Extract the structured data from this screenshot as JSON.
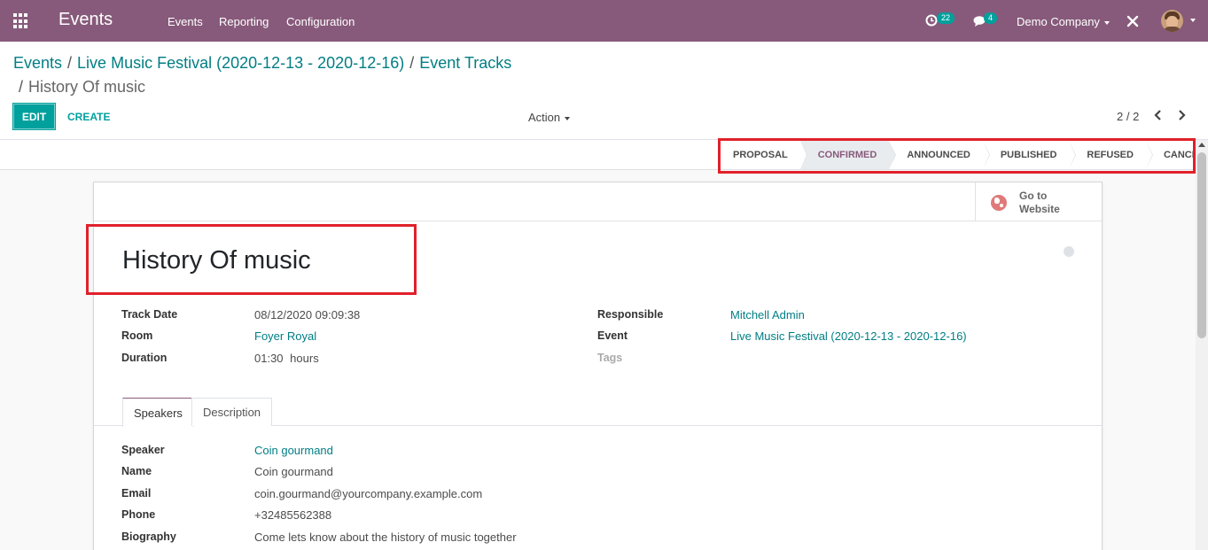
{
  "navbar": {
    "brand": "Events",
    "menu": [
      "Events",
      "Reporting",
      "Configuration"
    ],
    "activity_count": "22",
    "message_count": "4",
    "company": "Demo Company"
  },
  "breadcrumb": {
    "root": "Events",
    "event": "Live Music Festival (2020-12-13 - 2020-12-16)",
    "tracks": "Event Tracks",
    "current": "History Of music"
  },
  "toolbar": {
    "edit_label": "EDIT",
    "create_label": "CREATE",
    "action_label": "Action",
    "pager": "2 / 2"
  },
  "statusbar": {
    "states": [
      "PROPOSAL",
      "CONFIRMED",
      "ANNOUNCED",
      "PUBLISHED",
      "REFUSED",
      "CANCELLED"
    ],
    "active": "CONFIRMED"
  },
  "sheet": {
    "website_button": "Go to Website",
    "title": "History Of music",
    "left_fields": [
      {
        "label": "Track Date",
        "value": "08/12/2020 09:09:38"
      },
      {
        "label": "Room",
        "value": "Foyer Royal"
      },
      {
        "label": "Duration",
        "value": "01:30",
        "unit": "hours"
      }
    ],
    "right_fields": [
      {
        "label": "Responsible",
        "value": "Mitchell Admin"
      },
      {
        "label": "Event",
        "value": "Live Music Festival (2020-12-13 - 2020-12-16)"
      },
      {
        "label": "Tags",
        "value": ""
      }
    ],
    "tabs": [
      "Speakers",
      "Description"
    ],
    "speaker_fields": [
      {
        "label": "Speaker",
        "value": "Coin gourmand"
      },
      {
        "label": "Name",
        "value": "Coin gourmand"
      },
      {
        "label": "Email",
        "value": "coin.gourmand@yourcompany.example.com"
      },
      {
        "label": "Phone",
        "value": "+32485562388"
      },
      {
        "label": "Biography",
        "value": "Come lets know about the history of music together"
      }
    ]
  },
  "colors": {
    "navbar": "#875a7b",
    "accent": "#00a09d",
    "link": "#017e84",
    "highlight": "#e0212a"
  }
}
